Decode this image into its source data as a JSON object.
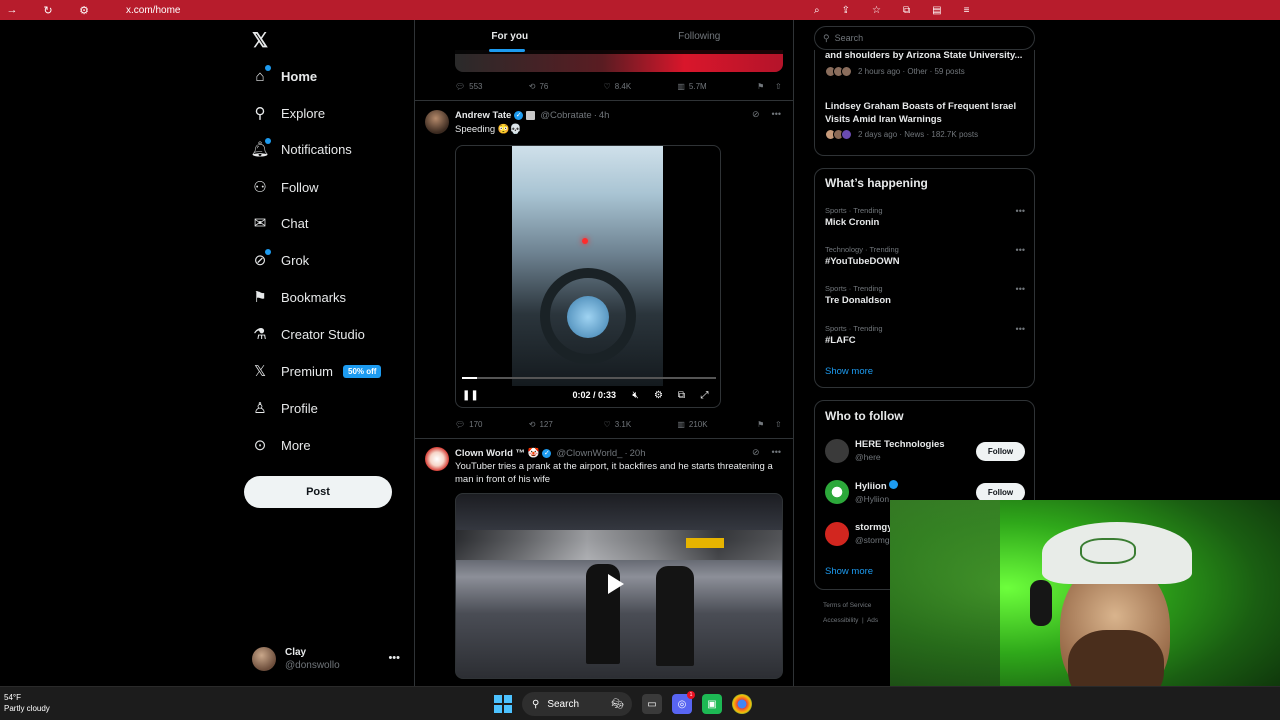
{
  "browser": {
    "url": "x.com/home"
  },
  "sidebar": {
    "items": [
      {
        "label": "Home"
      },
      {
        "label": "Explore"
      },
      {
        "label": "Notifications"
      },
      {
        "label": "Follow"
      },
      {
        "label": "Chat"
      },
      {
        "label": "Grok"
      },
      {
        "label": "Bookmarks"
      },
      {
        "label": "Creator Studio"
      },
      {
        "label": "Premium",
        "badge": "50% off"
      },
      {
        "label": "Profile"
      },
      {
        "label": "More"
      }
    ],
    "post_label": "Post",
    "account": {
      "name": "Clay",
      "handle": "@donswollo"
    }
  },
  "feed": {
    "tabs": [
      "For you",
      "Following"
    ],
    "prev_actions": {
      "replies": "553",
      "reposts": "76",
      "likes": "8.4K",
      "views": "5.7M"
    },
    "tweet1": {
      "name": "Andrew Tate",
      "handle": "@Cobratate",
      "time": "4h",
      "text": "Speeding 😳💀",
      "video_time": "0:02 / 0:33",
      "video_progress": 0.06,
      "actions": {
        "replies": "170",
        "reposts": "127",
        "likes": "3.1K",
        "views": "210K"
      }
    },
    "tweet2": {
      "name": "Clown World ™ 🤡",
      "handle": "@ClownWorld_",
      "time": "20h",
      "text": "YouTuber tries a prank at the airport, it backfires and he starts threatening a man in front of his wife"
    }
  },
  "right": {
    "search_placeholder": "Search",
    "news": [
      {
        "title": "and shoulders by Arizona State University...",
        "meta": "2 hours ago · Other · 59 posts"
      },
      {
        "title": "Lindsey Graham Boasts of Frequent Israel Visits Amid Iran Warnings",
        "meta": "2 days ago · News · 182.7K posts"
      }
    ],
    "happening": {
      "title": "What’s happening",
      "trends": [
        {
          "context": "Sports · Trending",
          "name": "Mick Cronin"
        },
        {
          "context": "Technology · Trending",
          "name": "#YouTubeDOWN"
        },
        {
          "context": "Sports · Trending",
          "name": "Tre Donaldson"
        },
        {
          "context": "Sports · Trending",
          "name": "#LAFC"
        }
      ],
      "show_more": "Show more"
    },
    "who_to_follow": {
      "title": "Who to follow",
      "accounts": [
        {
          "name": "HERE Technologies",
          "handle": "@here",
          "follow": "Follow"
        },
        {
          "name": "Hyliion",
          "handle": "@Hyliion",
          "follow": "Follow"
        },
        {
          "name": "stormgy",
          "handle": "@stormg"
        }
      ],
      "show_more": "Show more"
    },
    "footer": [
      "Terms of Service",
      "Accessibility",
      "Ads"
    ]
  },
  "taskbar": {
    "temp": "54°F",
    "weather": "Partly cloudy",
    "search": "Search",
    "discord_badge": "1"
  },
  "colors": {
    "accent": "#1d9bf0",
    "browser_bar": "#b71c2c"
  }
}
